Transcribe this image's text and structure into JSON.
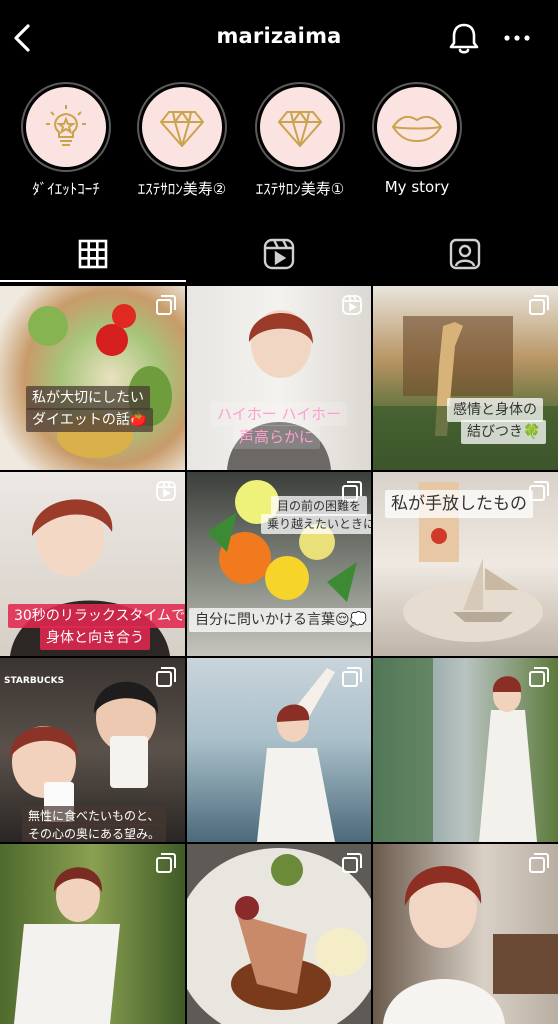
{
  "header": {
    "title": "marizaima"
  },
  "highlights": [
    {
      "label": "ﾀﾞｲｴｯﾄｺｰﾁ",
      "icon": "lightbulb-star-icon"
    },
    {
      "label": "ｴｽﾃｻﾛﾝ美寿②",
      "icon": "diamond-icon"
    },
    {
      "label": "ｴｽﾃｻﾛﾝ美寿①",
      "icon": "diamond-icon"
    },
    {
      "label": "My story",
      "icon": "lips-icon"
    }
  ],
  "tabs": [
    {
      "name": "grid",
      "icon": "grid-icon",
      "active": true
    },
    {
      "name": "reels",
      "icon": "reels-icon",
      "active": false
    },
    {
      "name": "tagged",
      "icon": "tagged-user-icon",
      "active": false
    }
  ],
  "posts": [
    {
      "type": "carousel",
      "captions": [
        "私が大切にしたい",
        "ダイエットの話🍅"
      ]
    },
    {
      "type": "reel",
      "captions": [
        "ハイホー ハイホー",
        "声高らかに"
      ]
    },
    {
      "type": "carousel",
      "captions": [
        "感情と身体の",
        "結びつき🍀"
      ]
    },
    {
      "type": "reel",
      "captions": [
        "30秒のリラックスタイムで",
        "身体と向き合う"
      ]
    },
    {
      "type": "carousel",
      "captions": [
        "目の前の困難を",
        "乗り越えたいときに",
        "自分に問いかける言葉😌💭"
      ]
    },
    {
      "type": "carousel",
      "captions": [
        "私が手放したもの"
      ]
    },
    {
      "type": "carousel",
      "captions": [
        "無性に食べたいものと、",
        "その心の奥にある望み。"
      ],
      "signage": "STARBUCKS"
    },
    {
      "type": "carousel",
      "captions": []
    },
    {
      "type": "carousel",
      "captions": []
    },
    {
      "type": "carousel",
      "captions": []
    },
    {
      "type": "carousel",
      "captions": []
    },
    {
      "type": "carousel",
      "captions": []
    }
  ],
  "colors": {
    "background": "#000000",
    "highlight_fill": "#fbe3e2",
    "highlight_icon": "#c9a44c"
  }
}
